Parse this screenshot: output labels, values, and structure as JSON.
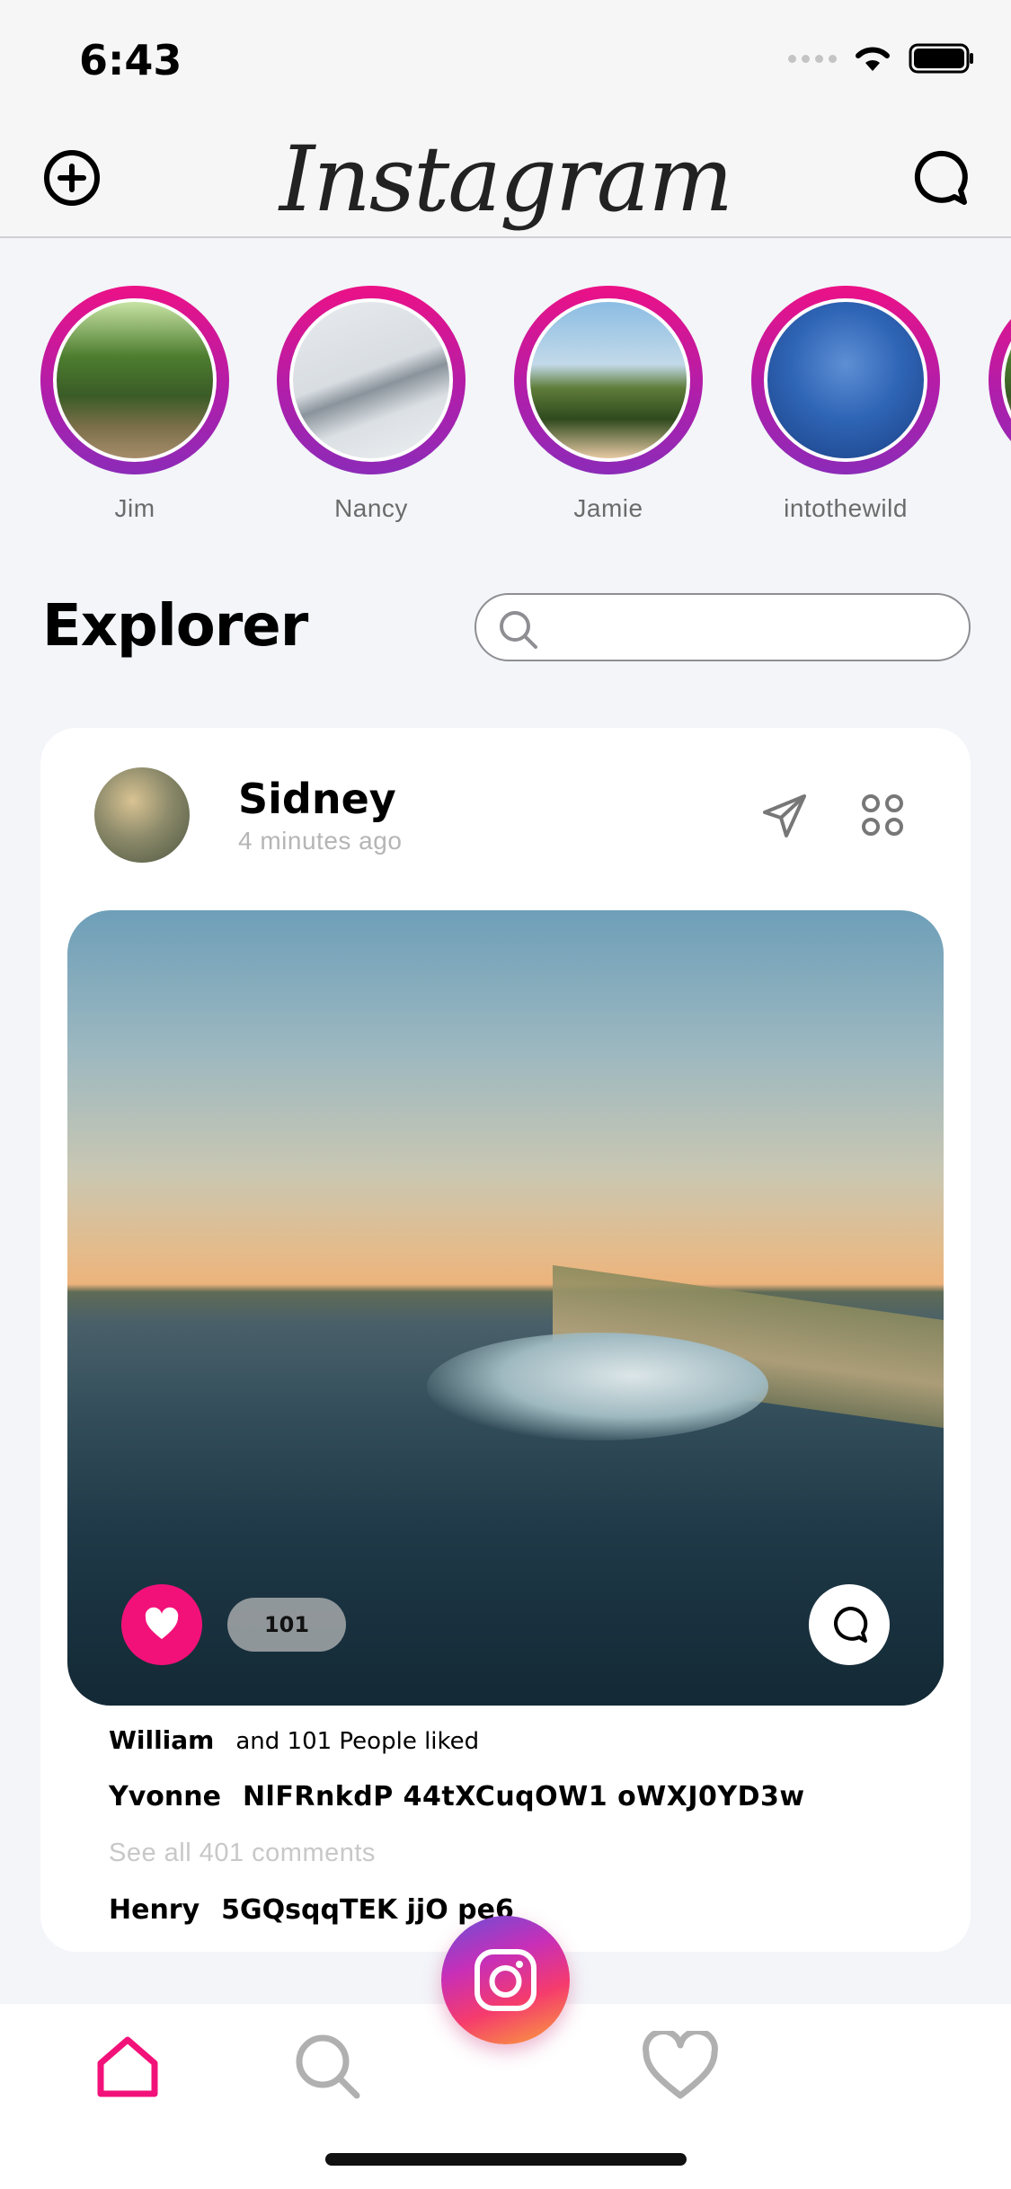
{
  "status_bar": {
    "time": "6:43"
  },
  "header": {
    "logo": "Instagram"
  },
  "stories": [
    {
      "name": "Jim"
    },
    {
      "name": "Nancy"
    },
    {
      "name": "Jamie"
    },
    {
      "name": "intothewild"
    }
  ],
  "explorer": {
    "title": "Explorer",
    "search_value": "",
    "search_placeholder": ""
  },
  "post": {
    "user": "Sidney",
    "time": "4 minutes ago",
    "likes": "101",
    "liked_by_name": "William",
    "liked_by_text": "and 101 People liked",
    "caption_user": "Yvonne",
    "caption_text": "NlFRnkdP 44tXCuqOW1 oWXJ0YD3w",
    "see_all_comments": "See all 401 comments",
    "comment_user": "Henry",
    "comment_text": "5GQsqqTEK jjO pe6"
  },
  "colors": {
    "accent": "#f21179",
    "story_ring_start": "#ec1186",
    "story_ring_end": "#8c2bb8"
  },
  "icons": {
    "header_left": "add-circle-icon",
    "header_right": "chat-bubble-icon",
    "post_send": "send-icon",
    "post_more": "more-grid-icon",
    "like": "heart-icon",
    "comment": "comment-icon",
    "tab_home": "home-icon",
    "tab_search": "search-icon",
    "tab_likes": "heart-outline-icon",
    "fab": "camera-icon"
  }
}
